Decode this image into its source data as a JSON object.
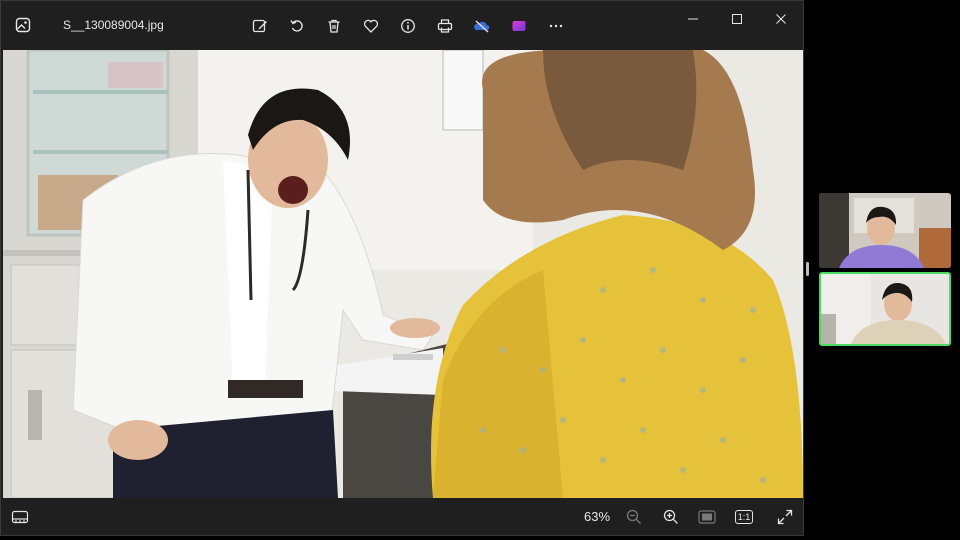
{
  "title_bar": {
    "filename": "S__130089004.jpg",
    "app_icon": "photos-app-icon",
    "tools": [
      "edit-icon",
      "rotate-icon",
      "delete-icon",
      "favorite-icon",
      "info-icon",
      "print-icon",
      "onedrive-icon",
      "clipchamp-icon",
      "more-icon"
    ],
    "window_controls": [
      "minimize-icon",
      "maximize-icon",
      "close-icon"
    ]
  },
  "bottom_bar": {
    "zoom_level": "63%",
    "actual_size_label": "1:1",
    "controls": [
      "filmstrip-icon",
      "zoom-out-icon",
      "zoom-in-icon",
      "fit-icon",
      "actual-size-icon",
      "fullscreen-icon"
    ]
  },
  "colors": {
    "window_bg": "#1f1f1f",
    "active_speaker_border": "#4cd964",
    "accent_purple": "#6f4cd6"
  }
}
